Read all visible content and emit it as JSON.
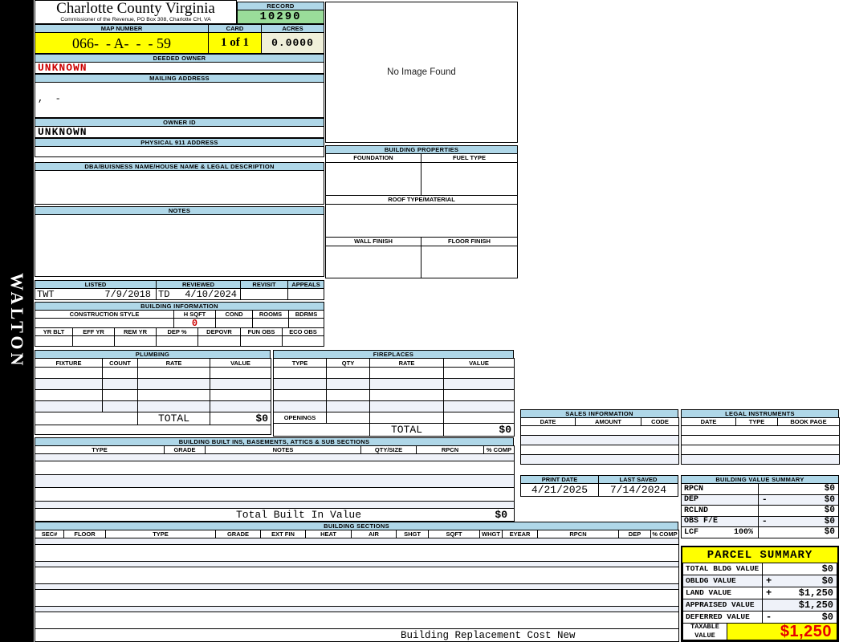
{
  "sidebar": {
    "watermark": "WALTON"
  },
  "header": {
    "county": "Charlotte County Virginia",
    "commissioner_line": "Commissioner of the Revenue, PO Box 308, Charlotte CH, VA",
    "record_label": "RECORD",
    "record_value": "10290",
    "map_number_label": "MAP NUMBER",
    "map_number_value": "066-  - A-  -  - 59",
    "card_label": "CARD",
    "card_value": "1 of 1",
    "acres_label": "ACRES",
    "acres_value": "0.0000"
  },
  "owner": {
    "deeded_owner_label": "DEEDED OWNER",
    "deeded_owner_value": "UNKNOWN",
    "mailing_address_label": "MAILING ADDRESS",
    "mailing_address_value": ",  -",
    "owner_id_label": "OWNER ID",
    "owner_id_value": "UNKNOWN",
    "physical_address_label": "PHYSICAL 911 ADDRESS",
    "dba_label": "DBA/BUISNESS NAME/HOUSE NAME & LEGAL DESCRIPTION",
    "notes_label": "NOTES"
  },
  "image_panel": {
    "placeholder": "No Image Found"
  },
  "building_properties": {
    "title": "BUILDING PROPERTIES",
    "foundation_label": "FOUNDATION",
    "fuel_type_label": "FUEL TYPE",
    "roof_label": "ROOF TYPE/MATERIAL",
    "wall_finish_label": "WALL FINISH",
    "floor_finish_label": "FLOOR FINISH"
  },
  "review": {
    "listed_label": "LISTED",
    "listed_by": "TWT",
    "listed_date": "7/9/2018",
    "reviewed_label": "REVIEWED",
    "reviewed_by": "TD",
    "reviewed_date": "4/10/2024",
    "revisit_label": "REVISIT",
    "appeals_label": "APPEALS"
  },
  "building_information": {
    "title": "BUILDING INFORMATION",
    "row1_headers": [
      "CONSTRUCTION STYLE",
      "H SQFT",
      "COND",
      "ROOMS",
      "BDRMS"
    ],
    "h_sqft_value": "0",
    "row2_headers": [
      "YR BLT",
      "EFF YR",
      "REM YR",
      "DEP %",
      "DEPOVR",
      "FUN OBS",
      "ECO OBS"
    ]
  },
  "plumbing": {
    "title": "PLUMBING",
    "headers": [
      "FIXTURE",
      "COUNT",
      "RATE",
      "VALUE"
    ],
    "total_label": "TOTAL",
    "total_value": "$0"
  },
  "fireplaces": {
    "title": "FIREPLACES",
    "headers": [
      "TYPE",
      "QTY",
      "RATE",
      "VALUE"
    ],
    "openings_label": "OPENINGS",
    "total_label": "TOTAL",
    "total_value": "$0"
  },
  "built_ins": {
    "title": "BUILDING BUILT INS, BASEMENTS, ATTICS & SUB SECTIONS",
    "headers": [
      "TYPE",
      "GRADE",
      "NOTES",
      "QTY/SIZE",
      "RPCN",
      "% COMP"
    ],
    "total_label": "Total Built In Value",
    "total_value": "$0"
  },
  "building_sections": {
    "title": "BUILDING SECTIONS",
    "headers": [
      "SEC#",
      "FLOOR",
      "TYPE",
      "GRADE",
      "EXT FIN",
      "HEAT",
      "AIR",
      "SHGT",
      "SQFT",
      "WHGT",
      "EYEAR",
      "RPCN",
      "DEP",
      "% COMP"
    ],
    "footer": "Building Replacement Cost New"
  },
  "sales_information": {
    "title": "SALES INFORMATION",
    "headers": [
      "DATE",
      "AMOUNT",
      "CODE"
    ]
  },
  "legal_instruments": {
    "title": "LEGAL INSTRUMENTS",
    "headers": [
      "DATE",
      "TYPE",
      "BOOK PAGE"
    ]
  },
  "print_info": {
    "print_date_label": "PRINT DATE",
    "print_date": "4/21/2025",
    "last_saved_label": "LAST SAVED",
    "last_saved": "7/14/2024"
  },
  "building_value_summary": {
    "title": "BUILDING VALUE SUMMARY",
    "rows": [
      {
        "label": "RPCN",
        "op": "",
        "value": "$0"
      },
      {
        "label": "DEP",
        "op": "-",
        "value": "$0"
      },
      {
        "label": "RCLND",
        "op": "",
        "value": "$0"
      },
      {
        "label": "OBS F/E",
        "op": "-",
        "value": "$0"
      },
      {
        "label": "LCF",
        "pct": "100%",
        "op": "",
        "value": "$0"
      }
    ]
  },
  "parcel_summary": {
    "title": "PARCEL SUMMARY",
    "rows": [
      {
        "label": "TOTAL BLDG VALUE",
        "op": "",
        "value": "$0"
      },
      {
        "label": "OBLDG VALUE",
        "op": "+",
        "value": "$0"
      },
      {
        "label": "LAND VALUE",
        "op": "+",
        "value": "$1,250"
      },
      {
        "label": "APPRAISED VALUE",
        "op": "",
        "value": "$1,250"
      },
      {
        "label": "DEFERRED VALUE",
        "op": "-",
        "value": "$0"
      }
    ],
    "taxable_label": "TAXABLE VALUE",
    "taxable_value": "$1,250"
  },
  "colors": {
    "section_header_blue": "#AFD7E8",
    "highlight_yellow": "#FFFF00",
    "record_green": "#9ADD9A",
    "acres_cream": "#F0F0DA",
    "unknown_red": "#CC0000",
    "taxable_red": "#E60000"
  }
}
